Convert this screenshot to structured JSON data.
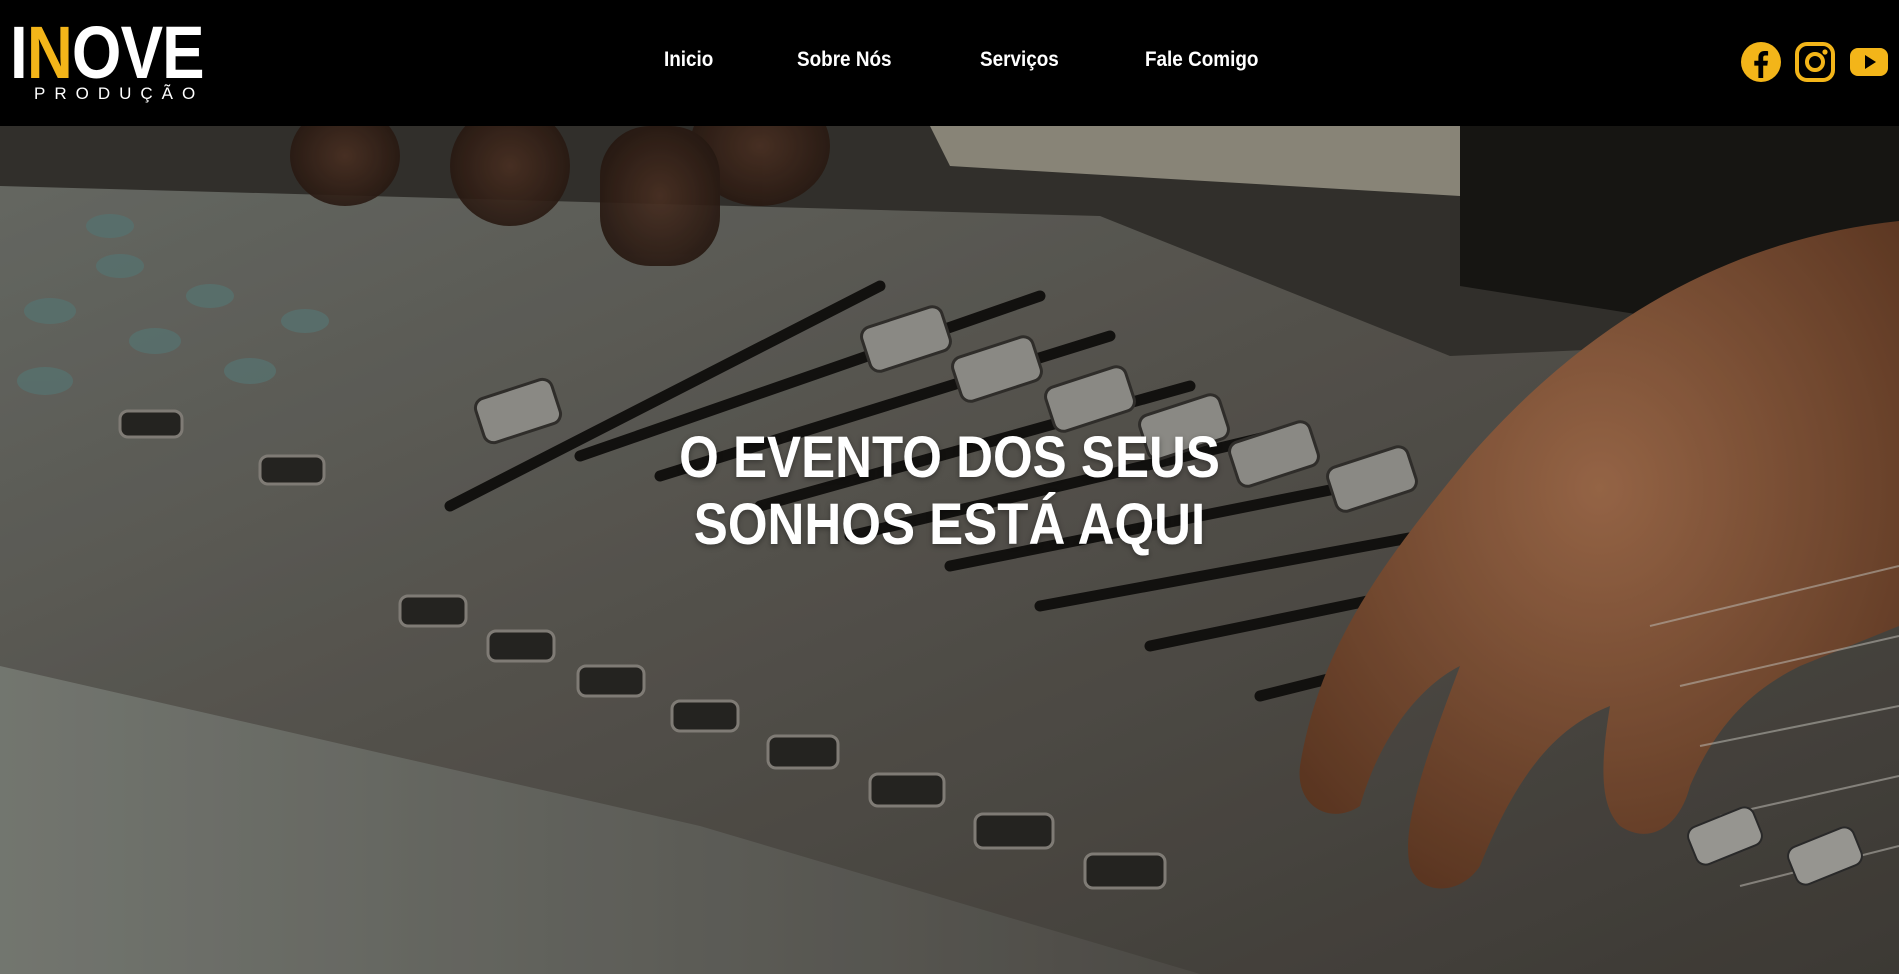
{
  "brand": {
    "logo_text": "INOVE",
    "logo_subtitle": "PRODUÇÃO",
    "accent_color": "#f3b519"
  },
  "nav": {
    "items": [
      {
        "label": "Inicio"
      },
      {
        "label": "Sobre Nós"
      },
      {
        "label": "Serviços"
      },
      {
        "label": "Fale Comigo"
      }
    ]
  },
  "social": {
    "icons": [
      "facebook-icon",
      "instagram-icon",
      "youtube-icon"
    ],
    "color": "#f3b519"
  },
  "hero": {
    "title_line1": "O EVENTO DOS SEUS",
    "title_line2": "SONHOS ESTÁ AQUI",
    "background": "audio-mixing-console-photo"
  }
}
